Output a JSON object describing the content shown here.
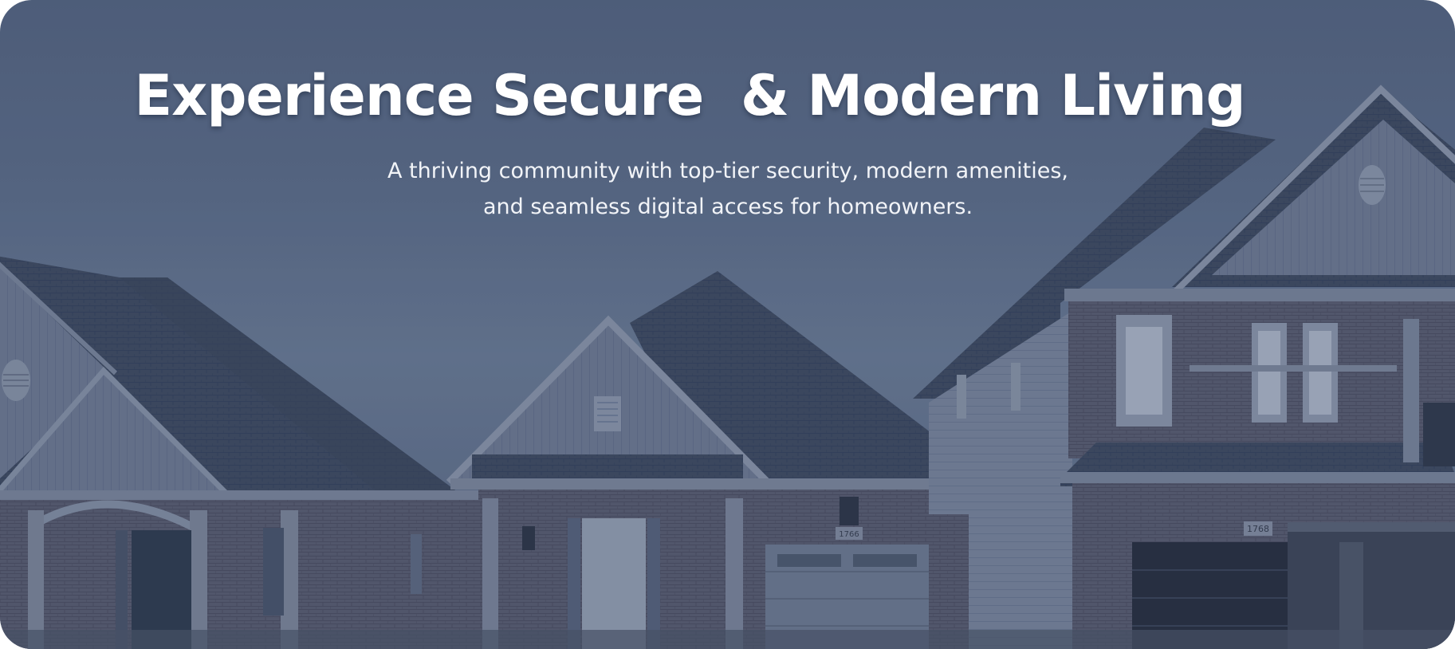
{
  "hero": {
    "title": "Experience Secure  & Modern Living",
    "subtitle": "A thriving community with top-tier security, modern amenities, and seamless digital access for homeowners."
  },
  "background": {
    "icon": "houses-photo",
    "house_numbers": [
      "1766",
      "1768"
    ]
  },
  "colors": {
    "sky_top": "#55647f",
    "sky_bottom": "#6b7b94",
    "text": "#ffffff"
  }
}
